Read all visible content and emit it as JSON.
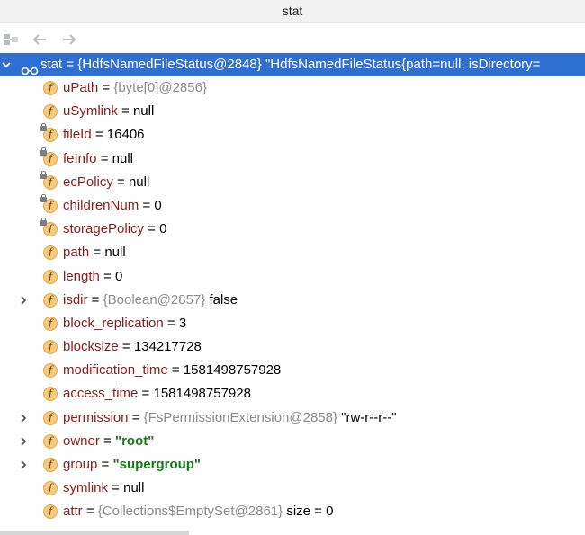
{
  "window": {
    "title": "stat"
  },
  "toolbar": {
    "restore_icon": "restore-layout-icon",
    "back_icon": "arrow-left-icon",
    "forward_icon": "arrow-right-icon"
  },
  "colors": {
    "selection": "#2f6fd1",
    "field_name": "#8b1c1c",
    "reference": "#8a8a8a",
    "string_value": "#137b13",
    "field_icon": "#f6c97c"
  },
  "root": {
    "text": "stat = {HdfsNamedFileStatus@2848} \"HdfsNamedFileStatus{path=null; isDirectory=",
    "expanded": true
  },
  "fields": [
    {
      "name": "uPath",
      "ref": "{byte[0]@2856}",
      "value": "",
      "str": "",
      "expandable": false,
      "final": false
    },
    {
      "name": "uSymlink",
      "ref": "",
      "value": "null",
      "str": "",
      "expandable": false,
      "final": false
    },
    {
      "name": "fileId",
      "ref": "",
      "value": "16406",
      "str": "",
      "expandable": false,
      "final": true
    },
    {
      "name": "feInfo",
      "ref": "",
      "value": "null",
      "str": "",
      "expandable": false,
      "final": true
    },
    {
      "name": "ecPolicy",
      "ref": "",
      "value": "null",
      "str": "",
      "expandable": false,
      "final": true
    },
    {
      "name": "childrenNum",
      "ref": "",
      "value": "0",
      "str": "",
      "expandable": false,
      "final": true
    },
    {
      "name": "storagePolicy",
      "ref": "",
      "value": "0",
      "str": "",
      "expandable": false,
      "final": true
    },
    {
      "name": "path",
      "ref": "",
      "value": "null",
      "str": "",
      "expandable": false,
      "final": false
    },
    {
      "name": "length",
      "ref": "",
      "value": "0",
      "str": "",
      "expandable": false,
      "final": false
    },
    {
      "name": "isdir",
      "ref": "{Boolean@2857}",
      "value": "false",
      "str": "",
      "expandable": true,
      "final": false
    },
    {
      "name": "block_replication",
      "ref": "",
      "value": "3",
      "str": "",
      "expandable": false,
      "final": false
    },
    {
      "name": "blocksize",
      "ref": "",
      "value": "134217728",
      "str": "",
      "expandable": false,
      "final": false
    },
    {
      "name": "modification_time",
      "ref": "",
      "value": "1581498757928",
      "str": "",
      "expandable": false,
      "final": false
    },
    {
      "name": "access_time",
      "ref": "",
      "value": "1581498757928",
      "str": "",
      "expandable": false,
      "final": false
    },
    {
      "name": "permission",
      "ref": "{FsPermissionExtension@2858}",
      "value": "\"rw-r--r--\"",
      "str": "",
      "expandable": true,
      "final": false
    },
    {
      "name": "owner",
      "ref": "",
      "value": "",
      "str": "\"root\"",
      "expandable": true,
      "final": false
    },
    {
      "name": "group",
      "ref": "",
      "value": "",
      "str": "\"supergroup\"",
      "expandable": true,
      "final": false
    },
    {
      "name": "symlink",
      "ref": "",
      "value": "null",
      "str": "",
      "expandable": false,
      "final": false
    },
    {
      "name": "attr",
      "ref": "{Collections$EmptySet@2861}",
      "value": "size = 0",
      "str": "",
      "expandable": false,
      "final": false
    }
  ]
}
